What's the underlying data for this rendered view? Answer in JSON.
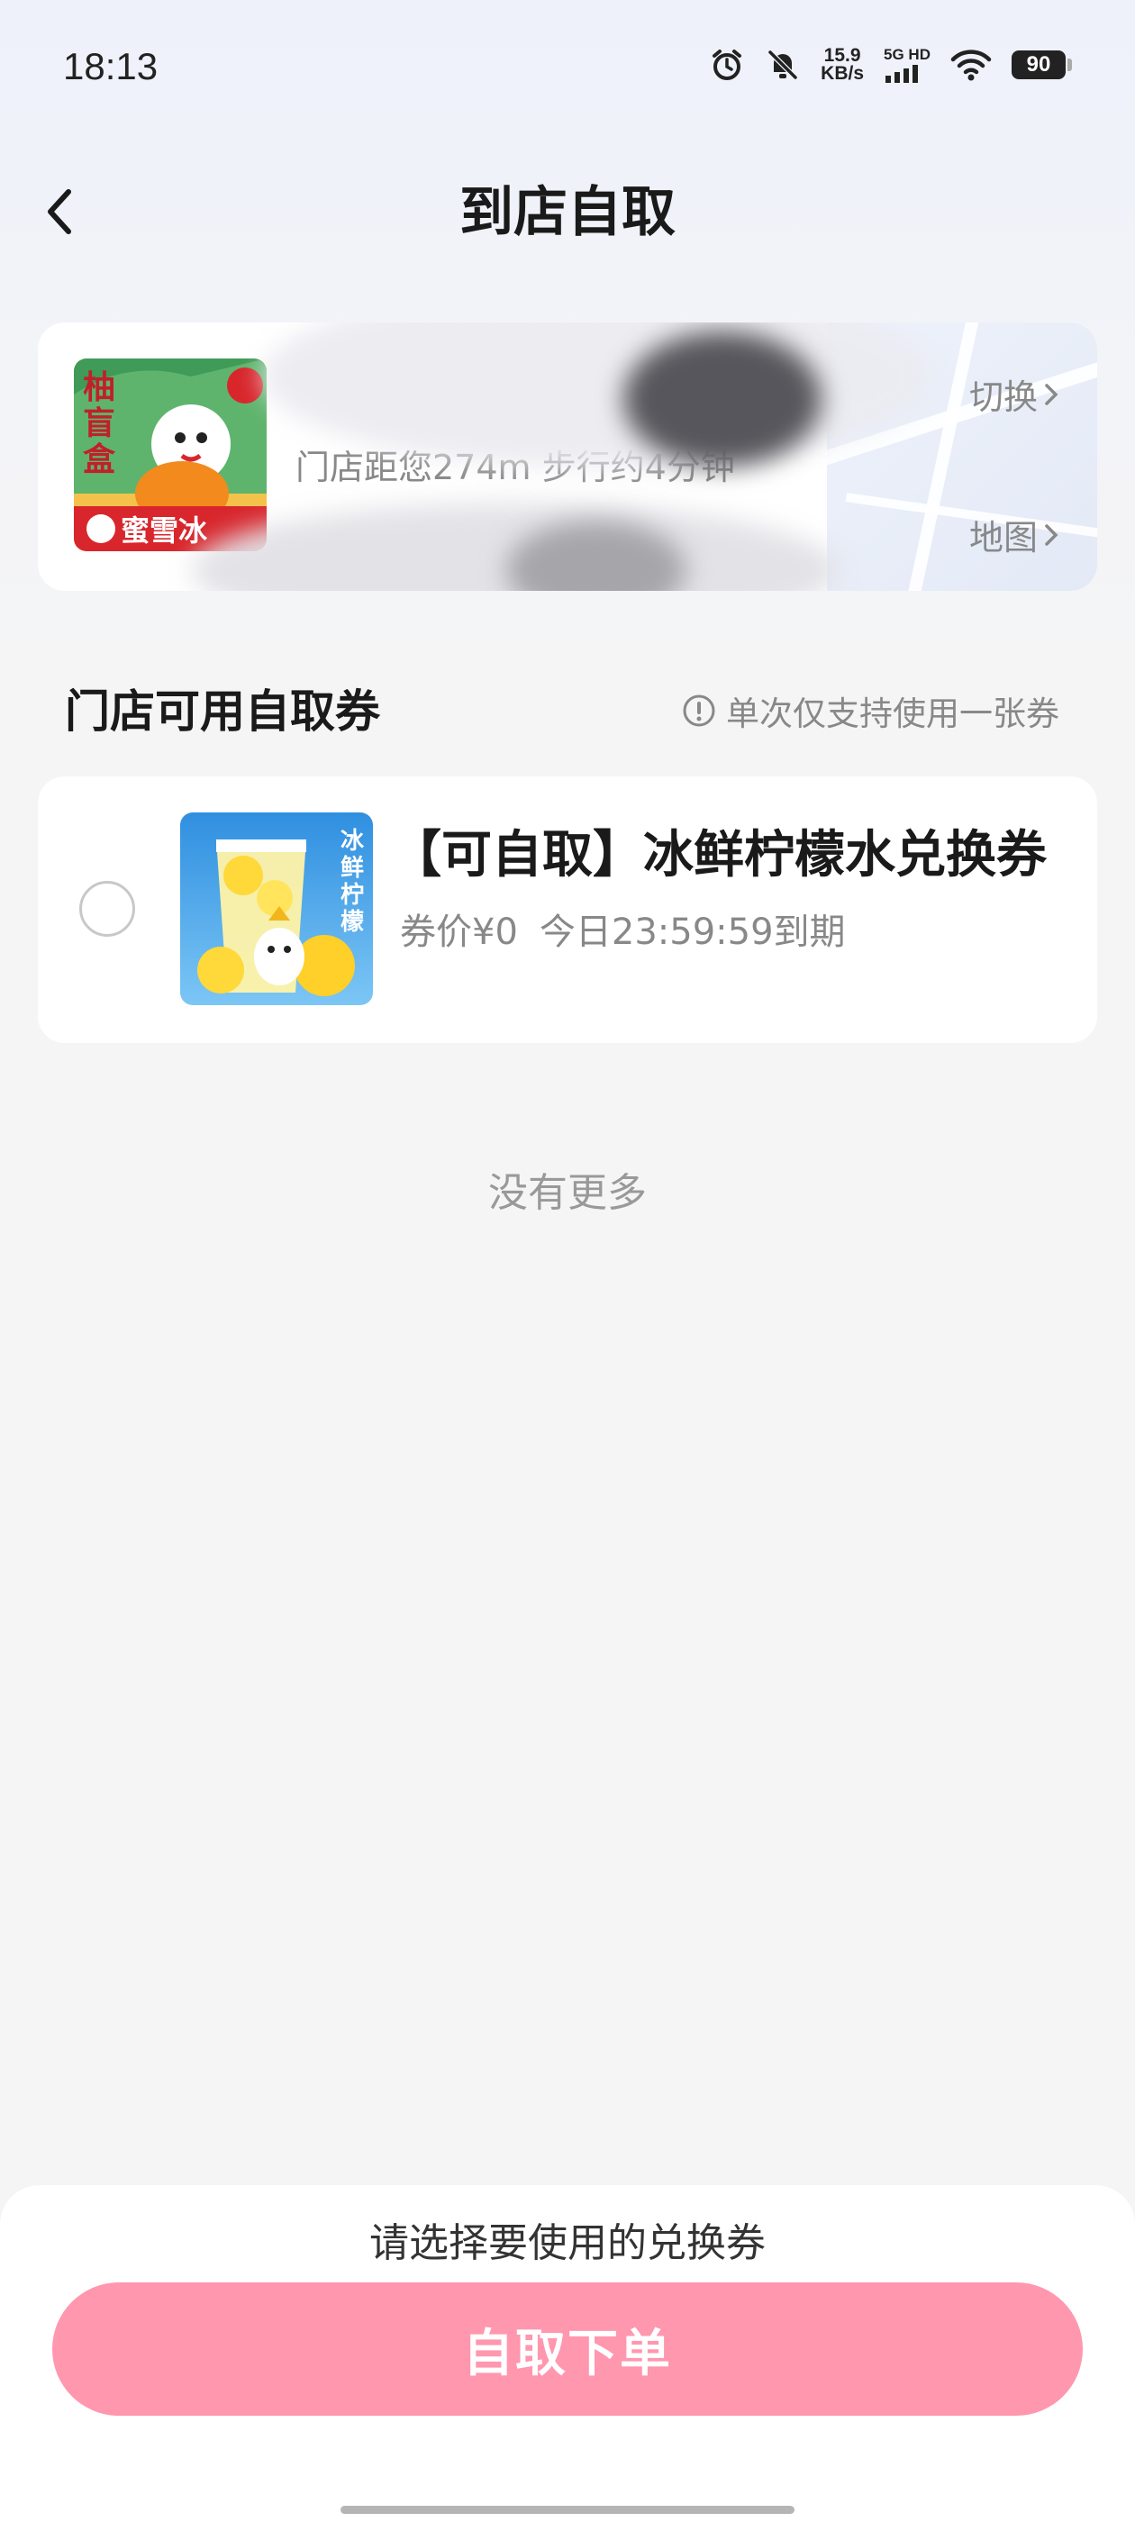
{
  "status_bar": {
    "time": "18:13",
    "net_speed_value": "15.9",
    "net_speed_unit": "KB/s",
    "network_label": "5G HD",
    "battery": "90",
    "icons": [
      "alarm-icon",
      "mute-icon",
      "cellular-signal-icon",
      "wifi-icon",
      "battery-icon"
    ]
  },
  "header": {
    "title": "到店自取",
    "back_icon": "chevron-left-icon"
  },
  "store": {
    "thumb_text_top": "柚盲盒",
    "thumb_brand": "蜜雪冰",
    "distance_text": "门店距您274m  步行约4分钟",
    "switch_label": "切换",
    "map_label": "地图"
  },
  "section": {
    "title": "门店可用自取券",
    "note": "单次仅支持使用一张券"
  },
  "coupons": [
    {
      "name": "【可自取】冰鲜柠檬水兑换券",
      "price": "券价¥0",
      "expiry": "今日23:59:59到期",
      "thumb_text": "冰鲜柠檬",
      "selected": false
    }
  ],
  "list_end_text": "没有更多",
  "footer": {
    "hint": "请选择要使用的兑换券",
    "order_button": "自取下单"
  },
  "colors": {
    "accent_pink": "#ff97ae",
    "brand_red": "#d8262c",
    "muted_text": "#888888"
  }
}
